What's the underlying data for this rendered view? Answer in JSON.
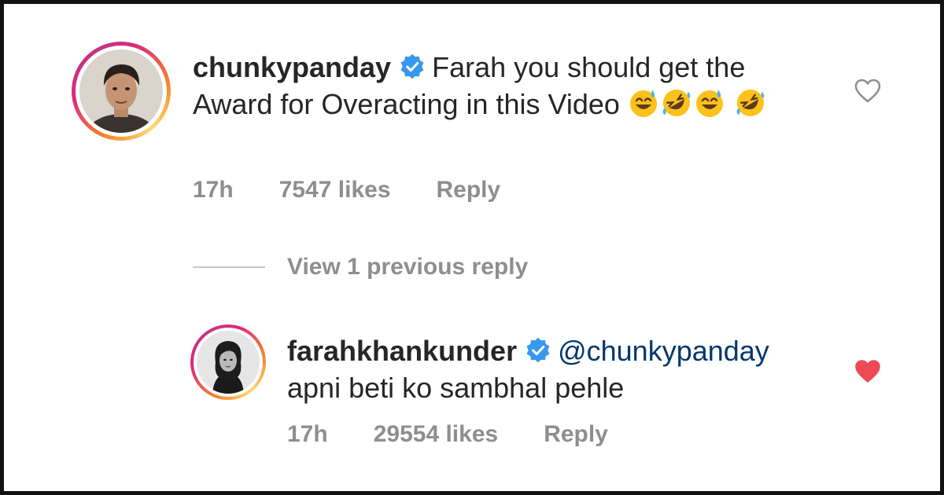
{
  "comments": [
    {
      "username": "chunkypanday",
      "verified": true,
      "text": "Farah you should get the Award for Overacting in this Video",
      "emojis": [
        "sweat-smile",
        "rofl",
        "sweat-smile",
        "rofl"
      ],
      "time": "17h",
      "likes": "7547 likes",
      "reply_label": "Reply",
      "liked": false
    },
    {
      "username": "farahkhankunder",
      "verified": true,
      "mention": "@chunkypanday",
      "text": "apni beti ko sambhal pehle",
      "time": "17h",
      "likes": "29554 likes",
      "reply_label": "Reply",
      "liked": true
    }
  ],
  "view_replies_label": "View 1 previous reply",
  "colors": {
    "heart_liked": "#ed4956",
    "heart_outline": "#8e8e8e",
    "verified_blue": "#3897f0",
    "mention": "#00376b",
    "muted": "#8e8e8e"
  }
}
